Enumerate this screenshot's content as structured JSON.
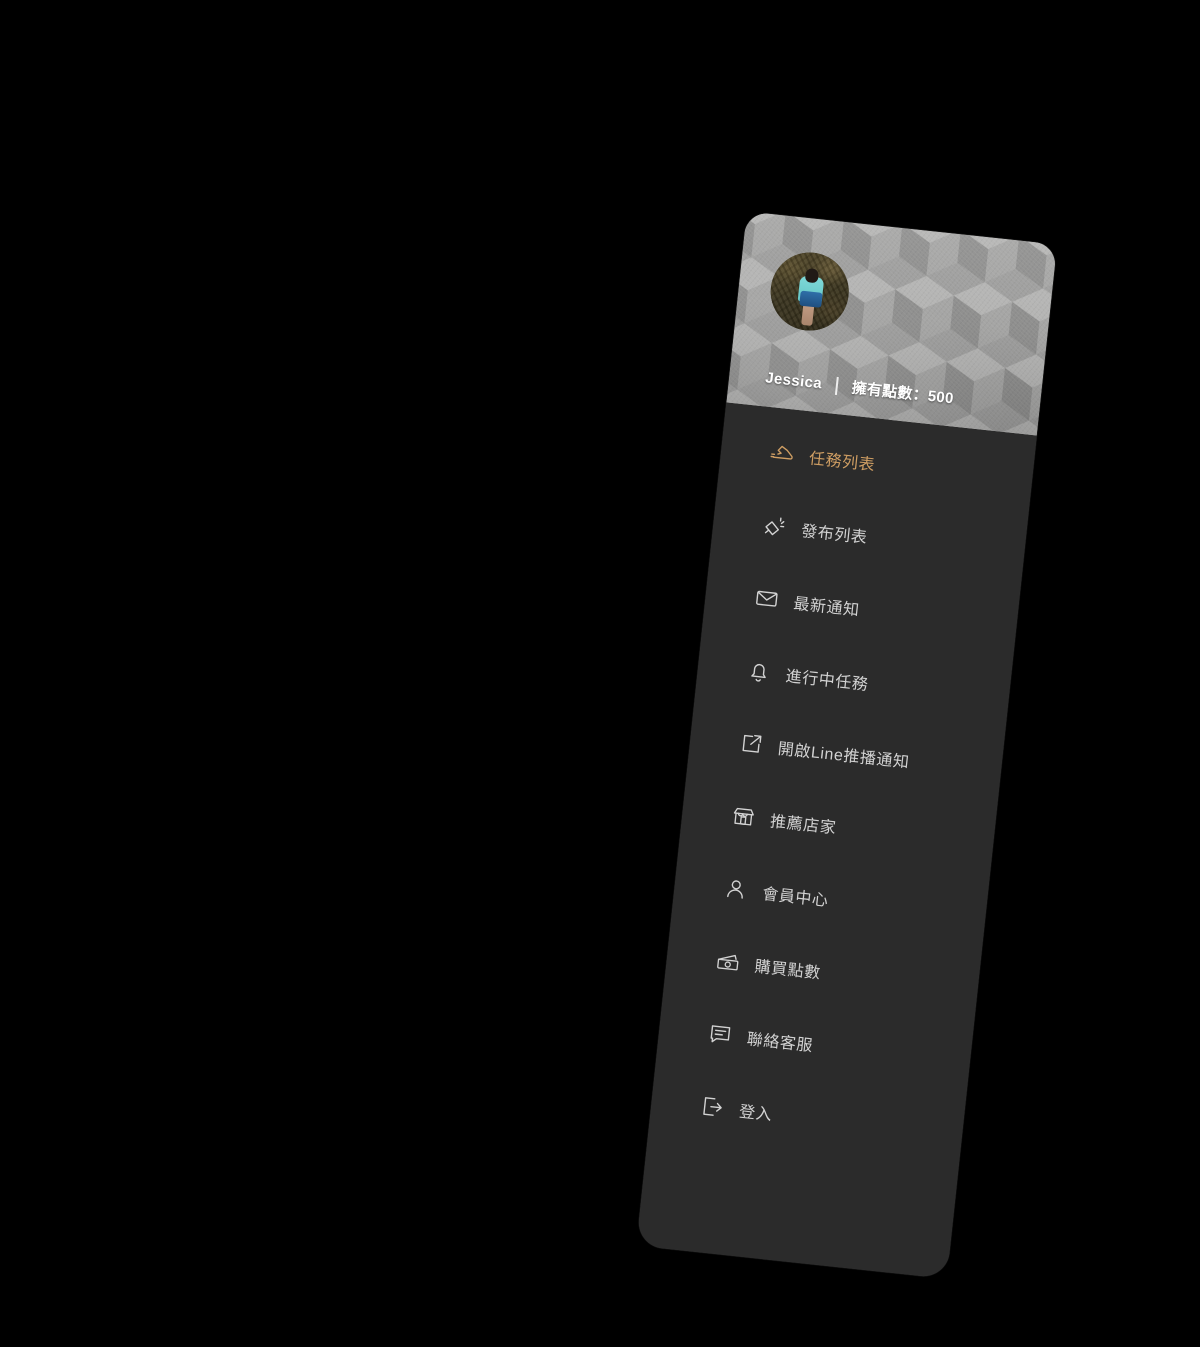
{
  "panel": {
    "accent_color": "#cf9e63",
    "menu_bg": "#2b2b2b",
    "header_bg": "#9e9e9d",
    "text_color": "#d2d2d2"
  },
  "profile": {
    "avatar_alt": "user-avatar-photo",
    "user_name": "Jessica",
    "divider": "|",
    "points_label": "擁有點數：500",
    "points_value": "500"
  },
  "menu": {
    "items": [
      {
        "label": "任務列表",
        "icon": "shoe-icon",
        "active": true
      },
      {
        "label": "發布列表",
        "icon": "megaphone-icon",
        "active": false
      },
      {
        "label": "最新通知",
        "icon": "envelope-icon",
        "active": false
      },
      {
        "label": "進行中任務",
        "icon": "bell-icon",
        "active": false
      },
      {
        "label": "開啟Line推播通知",
        "icon": "external-link-icon",
        "active": false
      },
      {
        "label": "推薦店家",
        "icon": "storefront-icon",
        "active": false
      },
      {
        "label": "會員中心",
        "icon": "user-icon",
        "active": false
      },
      {
        "label": "購買點數",
        "icon": "banknote-icon",
        "active": false
      },
      {
        "label": "聯絡客服",
        "icon": "chat-icon",
        "active": false
      },
      {
        "label": "登入",
        "icon": "login-icon",
        "active": false
      }
    ]
  }
}
